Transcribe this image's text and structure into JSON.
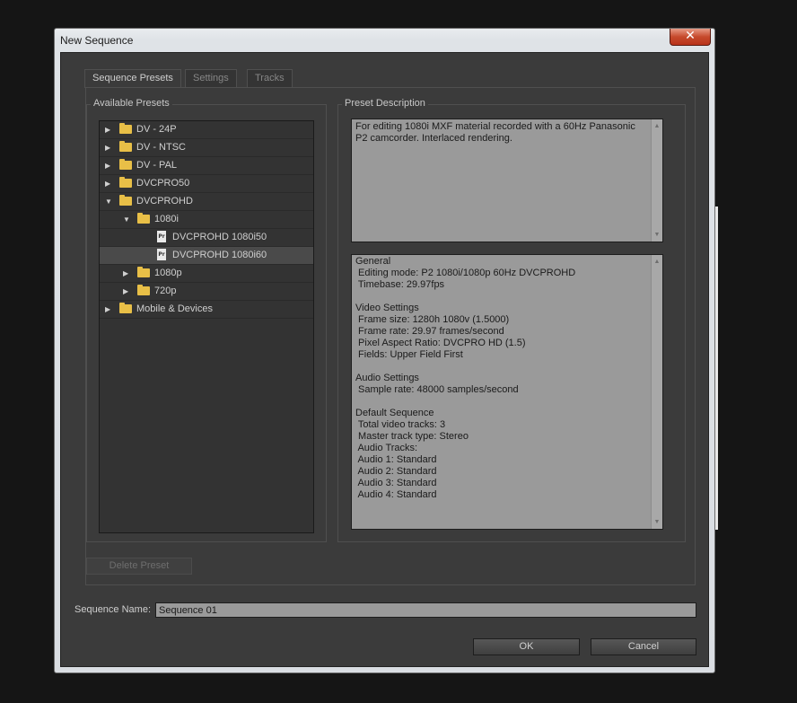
{
  "window": {
    "title": "New Sequence",
    "close_glyph": "✕"
  },
  "tabs": [
    {
      "label": "Sequence Presets",
      "active": true
    },
    {
      "label": "Settings",
      "active": false
    },
    {
      "label": "Tracks",
      "active": false
    }
  ],
  "presets": {
    "group_label": "Available Presets",
    "items": [
      {
        "label": "DV - 24P",
        "expanded": false,
        "type": "folder"
      },
      {
        "label": "DV - NTSC",
        "expanded": false,
        "type": "folder"
      },
      {
        "label": "DV - PAL",
        "expanded": false,
        "type": "folder"
      },
      {
        "label": "DVCPRO50",
        "expanded": false,
        "type": "folder"
      },
      {
        "label": "DVCPROHD",
        "expanded": true,
        "type": "folder"
      },
      {
        "label": "1080i",
        "expanded": true,
        "type": "folder"
      },
      {
        "label": "DVCPROHD 1080i50",
        "type": "preset"
      },
      {
        "label": "DVCPROHD 1080i60",
        "type": "preset",
        "selected": true
      },
      {
        "label": "1080p",
        "expanded": false,
        "type": "folder"
      },
      {
        "label": "720p",
        "expanded": false,
        "type": "folder"
      },
      {
        "label": "Mobile & Devices",
        "expanded": false,
        "type": "folder"
      }
    ],
    "preset_icon_text": "Pr",
    "delete_button": "Delete Preset"
  },
  "description": {
    "group_label": "Preset Description",
    "text": "For editing 1080i MXF material recorded with a 60Hz Panasonic P2 camcorder. Interlaced rendering.",
    "general_text": "General\n Editing mode: P2 1080i/1080p 60Hz DVCPROHD\n Timebase: 29.97fps\n\nVideo Settings\n Frame size: 1280h 1080v (1.5000)\n Frame rate: 29.97 frames/second\n Pixel Aspect Ratio: DVCPRO HD (1.5)\n Fields: Upper Field First\n\nAudio Settings\n Sample rate: 48000 samples/second\n\nDefault Sequence\n Total video tracks: 3\n Master track type: Stereo\n Audio Tracks:\n Audio 1: Standard\n Audio 2: Standard\n Audio 3: Standard\n Audio 4: Standard"
  },
  "sequence_name": {
    "label": "Sequence Name:",
    "value": "Sequence 01"
  },
  "buttons": {
    "ok": "OK",
    "cancel": "Cancel"
  },
  "colors": {
    "folder": "#e8bf47",
    "panel": "#3b3b3b",
    "field": "#9a9a9a",
    "close": "#c64a2c"
  }
}
